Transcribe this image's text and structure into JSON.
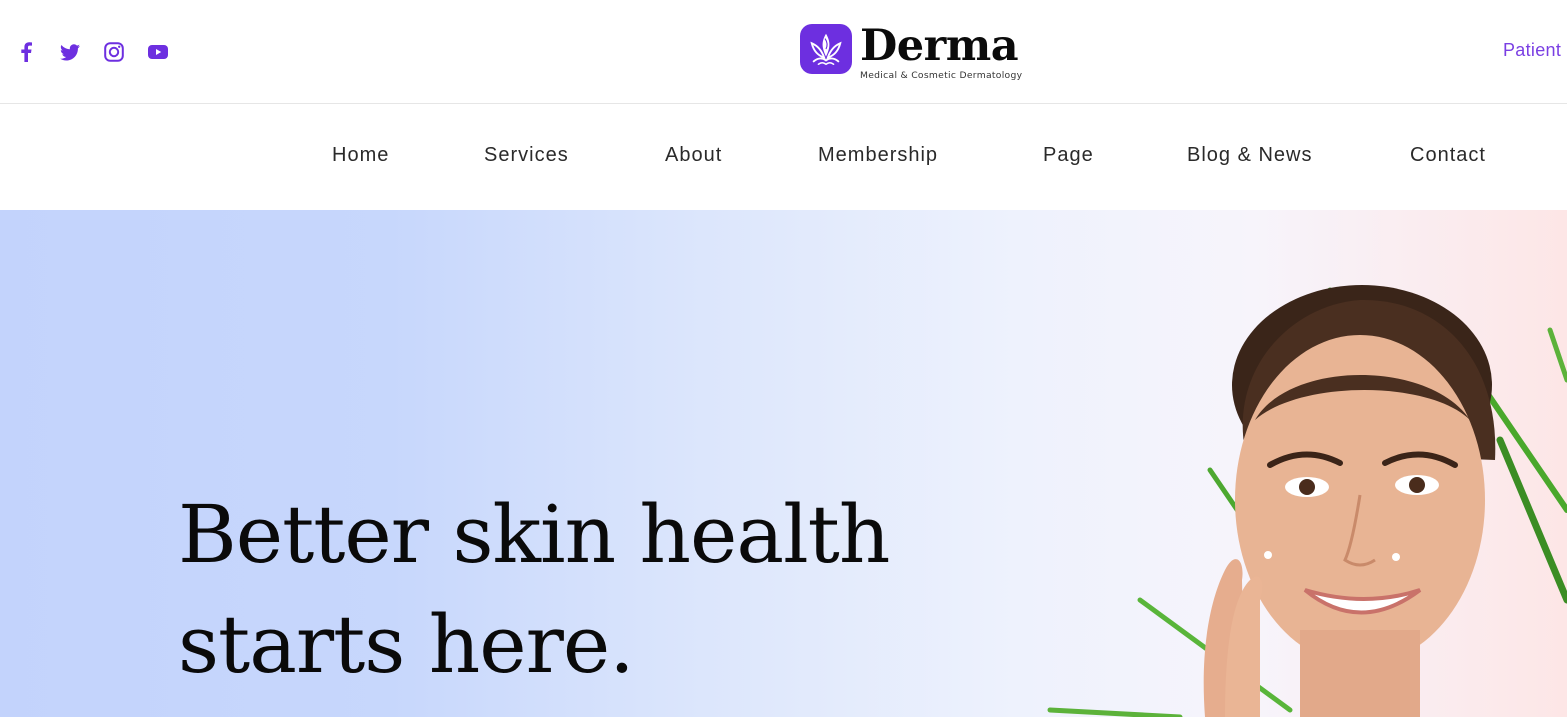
{
  "social": {
    "items": [
      {
        "name": "facebook"
      },
      {
        "name": "twitter"
      },
      {
        "name": "instagram"
      },
      {
        "name": "youtube"
      }
    ],
    "color": "#6d2fe0"
  },
  "brand": {
    "name": "Derma",
    "tagline": "Medical & Cosmetic Dermatology",
    "accent": "#6d2fe0"
  },
  "header": {
    "portal_link": "Patient"
  },
  "nav": {
    "items": [
      "Home",
      "Services",
      "About",
      "Membership",
      "Page",
      "Blog & News",
      "Contact"
    ]
  },
  "hero": {
    "title_line1": "Better skin health",
    "title_line2": "starts here.",
    "image": "woman-touching-face-with-palm-leaves"
  }
}
